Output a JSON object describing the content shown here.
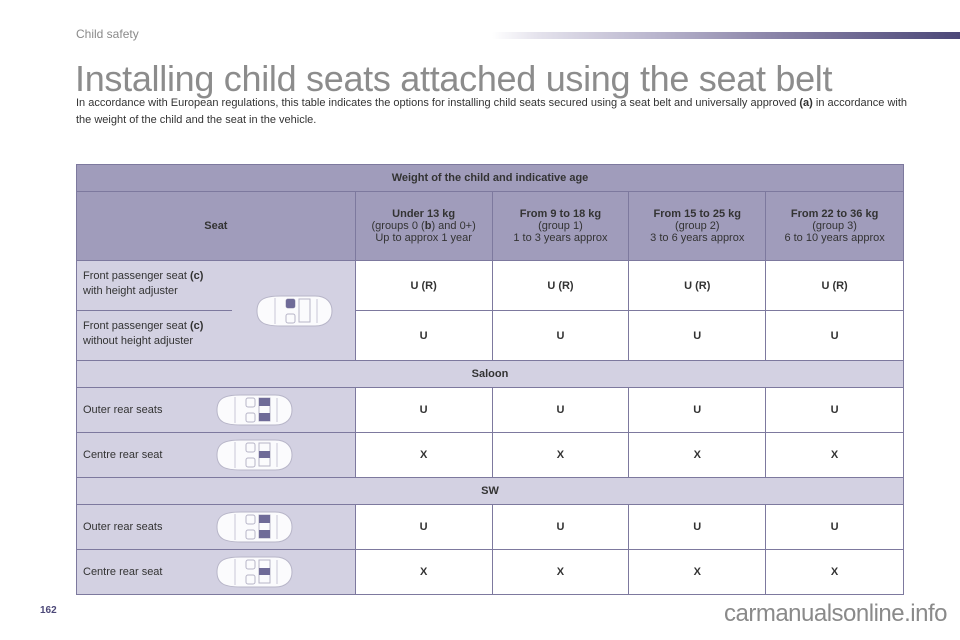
{
  "header": {
    "section": "Child safety",
    "accent_color": "#4c4878"
  },
  "title": "Installing child seats attached using the seat belt",
  "intro": {
    "text": "In accordance with European regulations, this table indicates the options for installing child seats secured using a seat belt and universally approved ",
    "note": "(a)",
    "text2": " in accordance with the weight of the child and the seat in the vehicle."
  },
  "table": {
    "caption": "Weight of the child and indicative age",
    "seat_header": "Seat",
    "columns": [
      {
        "weight": "Under 13 kg",
        "group_pre": "(groups 0 (",
        "group_bold": "b",
        "group_post": ") and 0+)",
        "age": "Up to approx 1 year"
      },
      {
        "weight": "From 9 to 18 kg",
        "group": "(group 1)",
        "age": "1 to 3 years approx"
      },
      {
        "weight": "From 15 to 25 kg",
        "group": "(group 2)",
        "age": "3 to 6 years approx"
      },
      {
        "weight": "From 22 to 36 kg",
        "group": "(group 3)",
        "age": "6 to 10 years approx"
      }
    ],
    "front": [
      {
        "label": "Front passenger seat ",
        "note": "(c)",
        "label2": "with height adjuster",
        "values": [
          "U (R)",
          "U (R)",
          "U (R)",
          "U (R)"
        ]
      },
      {
        "label": "Front passenger seat ",
        "note": "(c)",
        "label2": "without height adjuster",
        "values": [
          "U",
          "U",
          "U",
          "U"
        ]
      }
    ],
    "groups": [
      {
        "name": "Saloon",
        "rows": [
          {
            "label": "Outer rear seats",
            "values": [
              "U",
              "U",
              "U",
              "U"
            ]
          },
          {
            "label": "Centre rear seat",
            "values": [
              "X",
              "X",
              "X",
              "X"
            ]
          }
        ]
      },
      {
        "name": "SW",
        "rows": [
          {
            "label": "Outer rear seats",
            "values": [
              "U",
              "U",
              "U",
              "U"
            ]
          },
          {
            "label": "Centre rear seat",
            "values": [
              "X",
              "X",
              "X",
              "X"
            ]
          }
        ]
      }
    ]
  },
  "footer": {
    "page_number": "162",
    "watermark": "carmanualsonline.info"
  }
}
